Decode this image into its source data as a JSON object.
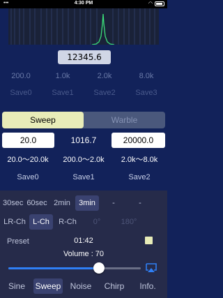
{
  "status": {
    "time": "4:30 PM",
    "signal": "•••"
  },
  "spectrum": {
    "peak_color": "#3ce07a",
    "line_color": "#3a4a80"
  },
  "frequency": {
    "value": "12345.6"
  },
  "presets": {
    "freqs": [
      "200.0",
      "1.0k",
      "2.0k",
      "8.0k"
    ],
    "saves": [
      "Save0",
      "Save1",
      "Save2",
      "Save3"
    ]
  },
  "mode_toggle": {
    "options": [
      "Sweep",
      "Warble"
    ],
    "active": "Sweep"
  },
  "sweep": {
    "low": "20.0",
    "current": "1016.7",
    "high": "20000.0"
  },
  "sweep_presets": {
    "ranges": [
      "20.0～20.0k",
      "200.0～2.0k",
      "2.0k～8.0k"
    ],
    "saves": [
      "Save0",
      "Save1",
      "Save2"
    ]
  },
  "timers": {
    "options": [
      "30sec",
      "60sec",
      "2min",
      "3min",
      "-",
      "-"
    ],
    "selected": "3min"
  },
  "channels": {
    "options": [
      "LR-Ch",
      "L-Ch",
      "R-Ch",
      "0°",
      "180°"
    ],
    "selected": "L-Ch"
  },
  "playback": {
    "preset_label": "Preset",
    "elapsed": "01:42",
    "volume_label": "Volume : 70",
    "volume": 0.7
  },
  "modes": {
    "options": [
      "Sine",
      "Sweep",
      "Noise",
      "Chirp",
      "Info."
    ],
    "selected": "Sweep"
  },
  "colors": {
    "accent": "#2f7ff5",
    "background": "#12225a",
    "toggle_active": "#e8ecb8"
  }
}
